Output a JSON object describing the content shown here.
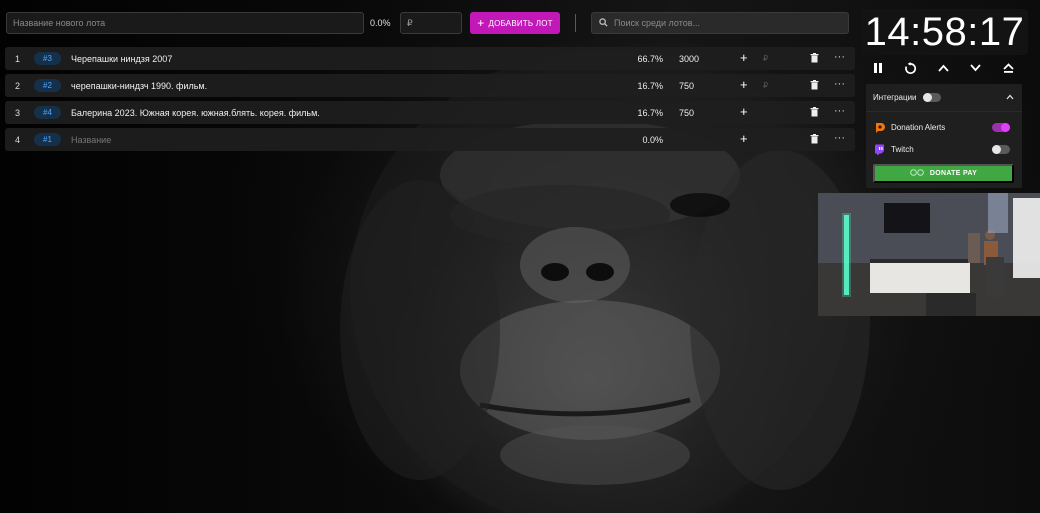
{
  "toolbar": {
    "lot_name_placeholder": "Название нового лота",
    "percent": "0.0%",
    "price_placeholder": "₽",
    "add_button_label": "ДОБАВИТЬ ЛОТ",
    "search_placeholder": "Поиск среди лотов..."
  },
  "lots": [
    {
      "index": "1",
      "badge": "#3",
      "name": "Черепашки ниндзя 2007",
      "percent": "66.7%",
      "amount": "3000",
      "currency": "₽"
    },
    {
      "index": "2",
      "badge": "#2",
      "name": "черепашки-ниндзч 1990. фильм.",
      "percent": "16.7%",
      "amount": "750",
      "currency": "₽"
    },
    {
      "index": "3",
      "badge": "#4",
      "name": "Балерина 2023. Южная корея. южная.блять. корея. фильм.",
      "percent": "16.7%",
      "amount": "750",
      "currency": ""
    },
    {
      "index": "4",
      "badge": "#1",
      "name": "",
      "name_placeholder": "Название",
      "percent": "0.0%",
      "amount": "",
      "currency": ""
    }
  ],
  "timer": {
    "time": "14:58:17"
  },
  "integrations": {
    "title": "Интеграции",
    "master_enabled": false,
    "items": [
      {
        "label": "Donation Alerts",
        "enabled": true,
        "icon": "donation-alerts-icon"
      },
      {
        "label": "Twitch",
        "enabled": false,
        "icon": "twitch-icon"
      }
    ],
    "donate_pay_label": "DONATE PAY"
  },
  "colors": {
    "accent": "#c318b8",
    "badge_text": "#4ea8ff",
    "donate_pay": "#3fa842",
    "twitch": "#9146ff",
    "donation_alerts": "#f57507"
  }
}
